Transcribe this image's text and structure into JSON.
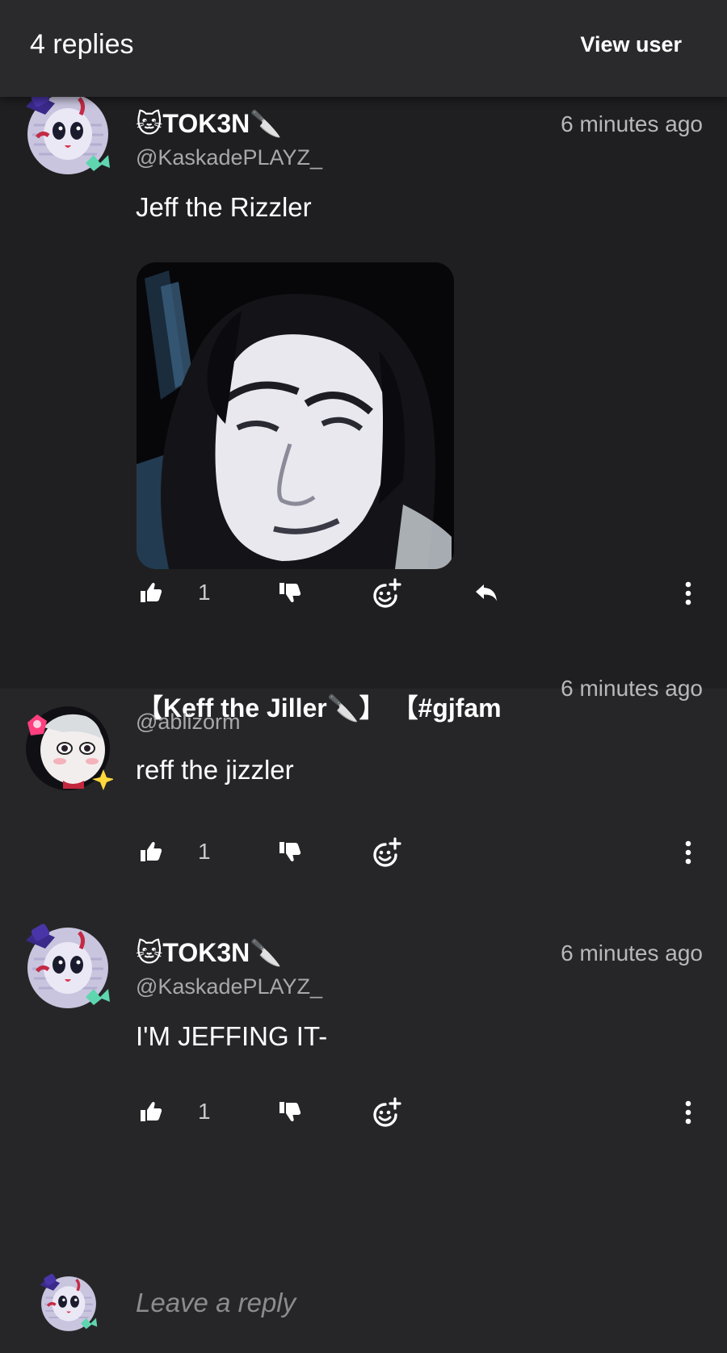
{
  "header": {
    "replies_count": "4 replies",
    "view_user": "View user"
  },
  "comments": [
    {
      "display_name": "TOK3N",
      "name_prefix_emoji": "🐱",
      "name_suffix_emoji": "🔪",
      "handle": "@KaskadePLAYZ_",
      "time": "6 minutes ago",
      "text": "Jeff the Rizzler",
      "likes": "1"
    },
    {
      "display_name": "【Keff the Jiller",
      "name_suffix_emoji": "🔪",
      "name_tail": "】 【#gjfam",
      "handle": "@ablizorm",
      "time": "6 minutes ago",
      "text": "reff the jizzler",
      "likes": "1"
    },
    {
      "display_name": "TOK3N",
      "name_prefix_emoji": "🐱",
      "name_suffix_emoji": "🔪",
      "handle": "@KaskadePLAYZ_",
      "time": "6 minutes ago",
      "text": "I'M JEFFING IT-",
      "likes": "1"
    }
  ],
  "reply_bar": {
    "placeholder": "Leave a reply"
  },
  "icons": [
    "thumbs-up-icon",
    "thumbs-down-icon",
    "add-emoji-icon",
    "reply-icon",
    "more-vertical-icon"
  ],
  "colors": {
    "background": "#1f1f21",
    "header": "#2a2a2c",
    "muted_text": "#a8a8ab"
  }
}
